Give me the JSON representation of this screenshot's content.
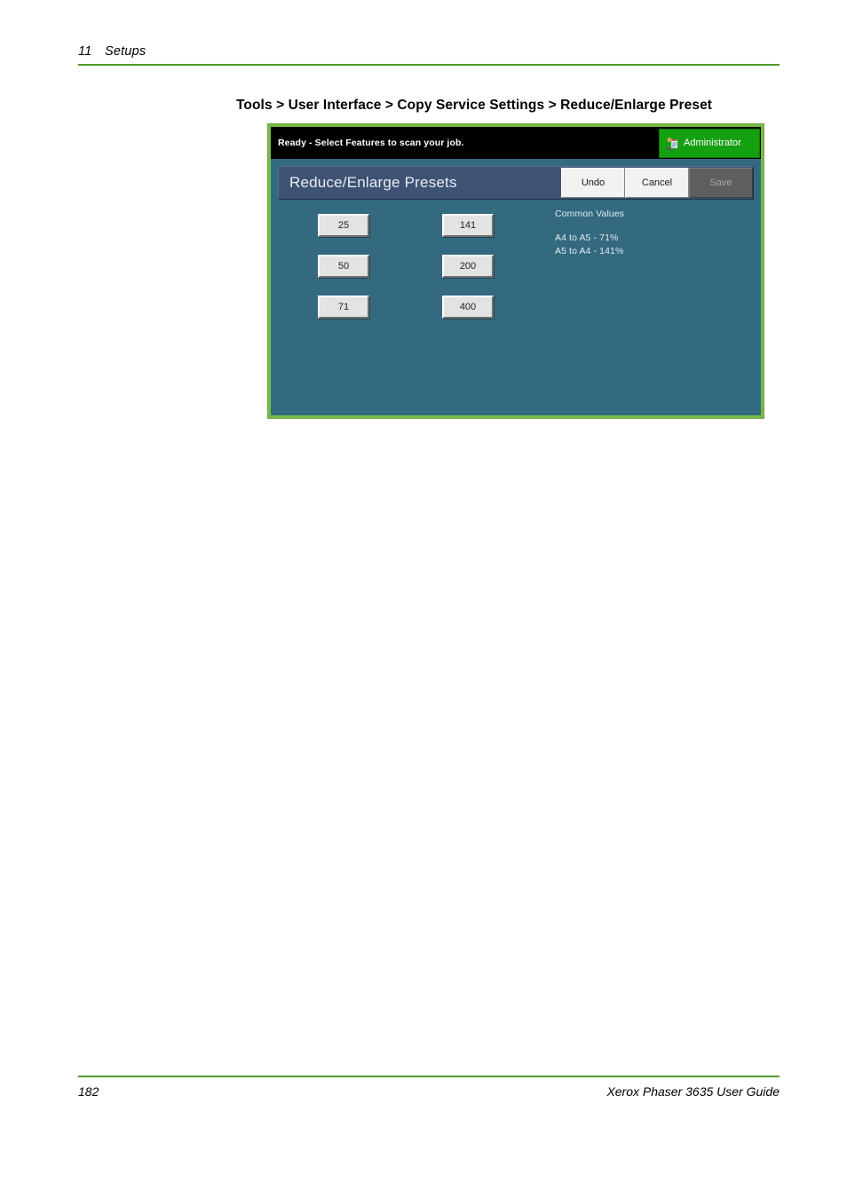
{
  "page": {
    "chapter_number": "11",
    "chapter_name": "Setups",
    "page_number": "182",
    "guide_title": "Xerox Phaser 3635 User Guide",
    "accent_green": "#4f9a2e"
  },
  "section": {
    "breadcrumb": "Tools > User Interface > Copy Service Settings > Reduce/Enlarge Preset"
  },
  "device_screen": {
    "frame_color": "#79b94a",
    "body_color": "#336a80",
    "status_bar": {
      "message": "Ready - Select Features to scan your job.",
      "admin_badge": {
        "label": "Administrator",
        "icon": "administrator-icon",
        "color": "#15a012"
      }
    },
    "title_bar": {
      "title": "Reduce/Enlarge Presets",
      "buttons": [
        {
          "label": "Undo",
          "state": "enabled"
        },
        {
          "label": "Cancel",
          "state": "enabled"
        },
        {
          "label": "Save",
          "state": "disabled"
        }
      ]
    },
    "presets": {
      "left_column": [
        "25",
        "50",
        "71"
      ],
      "right_column": [
        "141",
        "200",
        "400"
      ]
    },
    "common_values": {
      "heading": "Common Values",
      "lines": [
        "A4 to A5 - 71%",
        "A5 to A4 - 141%"
      ]
    }
  }
}
